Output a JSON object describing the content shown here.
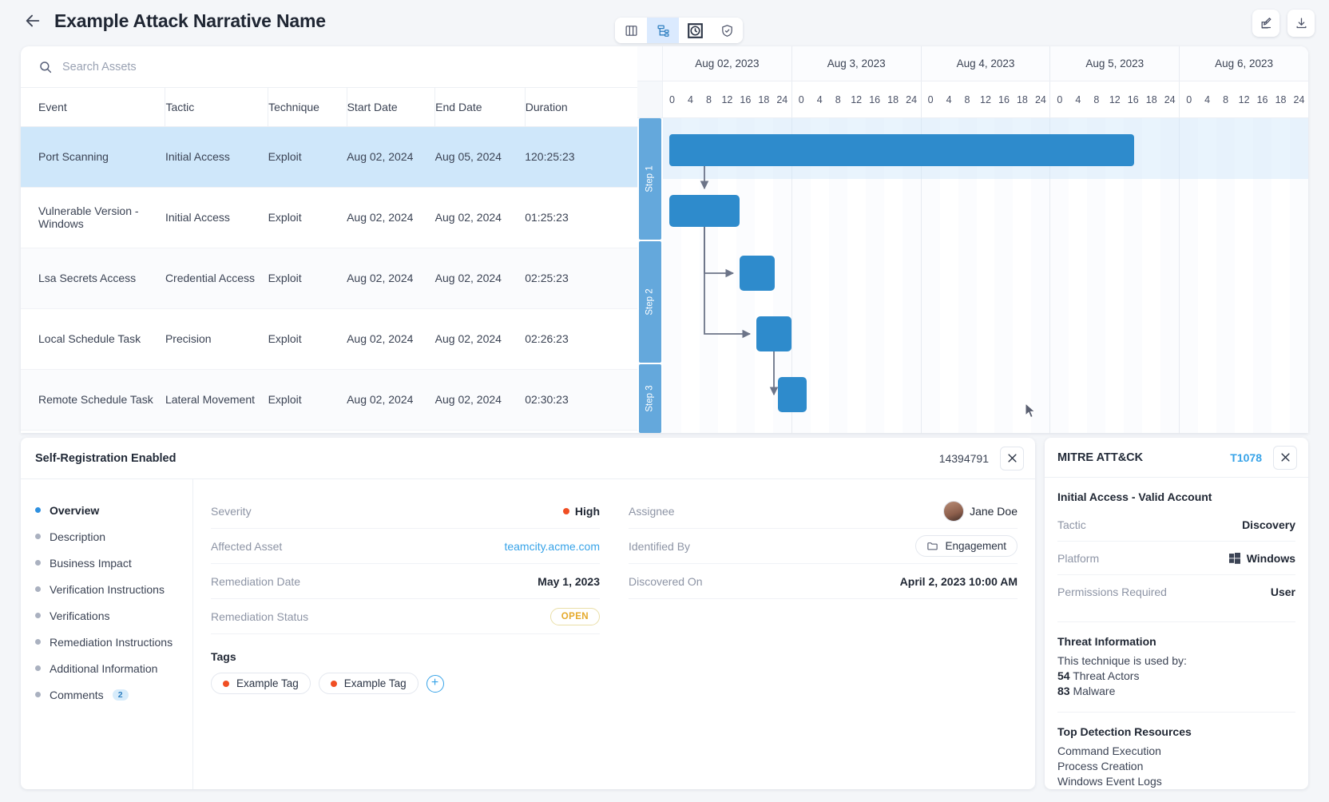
{
  "header": {
    "back_icon": "arrow-left-icon",
    "title": "Example Attack Narrative Name",
    "view_buttons": [
      {
        "name": "columns-view",
        "icon": "columns-icon",
        "active": false
      },
      {
        "name": "hierarchy-view",
        "icon": "hierarchy-icon",
        "active": true
      },
      {
        "name": "timeline-view",
        "icon": "clock-icon",
        "active": false
      },
      {
        "name": "security-view",
        "icon": "shield-check-icon",
        "active": false
      }
    ],
    "actions": [
      {
        "name": "edit-button",
        "icon": "edit-square-icon"
      },
      {
        "name": "download-button",
        "icon": "download-icon"
      }
    ]
  },
  "search": {
    "placeholder": "Search Assets",
    "value": ""
  },
  "table": {
    "columns": [
      "Event",
      "Tactic",
      "Technique",
      "Start Date",
      "End Date",
      "Duration"
    ],
    "rows": [
      {
        "event": "Port Scanning",
        "tactic": "Initial Access",
        "technique": "Exploit",
        "start": "Aug 02, 2024",
        "end": "Aug 05, 2024",
        "duration": "120:25:23"
      },
      {
        "event": "Vulnerable Version - Windows",
        "tactic": "Initial Access",
        "technique": "Exploit",
        "start": "Aug 02, 2024",
        "end": "Aug 02, 2024",
        "duration": "01:25:23"
      },
      {
        "event": "Lsa Secrets Access",
        "tactic": "Credential Access",
        "technique": "Exploit",
        "start": "Aug 02, 2024",
        "end": "Aug 02, 2024",
        "duration": "02:25:23"
      },
      {
        "event": "Local Schedule Task",
        "tactic": "Precision",
        "technique": "Exploit",
        "start": "Aug 02, 2024",
        "end": "Aug 02, 2024",
        "duration": "02:26:23"
      },
      {
        "event": "Remote Schedule Task",
        "tactic": "Lateral Movement",
        "technique": "Exploit",
        "start": "Aug 02, 2024",
        "end": "Aug 02, 2024",
        "duration": "02:30:23"
      }
    ]
  },
  "gantt": {
    "dates": [
      "Aug 02, 2023",
      "Aug 3, 2023",
      "Aug 4, 2023",
      "Aug 5, 2023",
      "Aug 6, 2023"
    ],
    "hour_ticks": [
      "0",
      "4",
      "8",
      "12",
      "16",
      "18",
      "24"
    ],
    "steps": [
      "Step 1",
      "Step 2",
      "Step 3"
    ],
    "bar_color": "#2e8bcc",
    "step_color": "#64a8dc"
  },
  "detail": {
    "title": "Self-Registration Enabled",
    "id": "14394791",
    "close_icon": "close-icon",
    "nav": [
      {
        "label": "Overview",
        "active": true
      },
      {
        "label": "Description",
        "active": false
      },
      {
        "label": "Business Impact",
        "active": false
      },
      {
        "label": "Verification Instructions",
        "active": false
      },
      {
        "label": "Verifications",
        "active": false
      },
      {
        "label": "Remediation Instructions",
        "active": false
      },
      {
        "label": "Additional Information",
        "active": false
      },
      {
        "label": "Comments",
        "active": false,
        "count": "2"
      }
    ],
    "left_fields": [
      {
        "label": "Severity",
        "value": "High",
        "type": "severity"
      },
      {
        "label": "Affected Asset",
        "value": "teamcity.acme.com",
        "type": "link"
      },
      {
        "label": "Remediation Date",
        "value": "May 1, 2023",
        "type": "text"
      },
      {
        "label": "Remediation Status",
        "value": "OPEN",
        "type": "pill"
      }
    ],
    "right_fields": [
      {
        "label": "Assignee",
        "value": "Jane Doe",
        "type": "avatar"
      },
      {
        "label": "Identified By",
        "value": "Engagement",
        "type": "chip"
      },
      {
        "label": "Discovered On",
        "value": "April 2, 2023 10:00 AM",
        "type": "text"
      }
    ],
    "tags_heading": "Tags",
    "tags": [
      "Example Tag",
      "Example Tag"
    ],
    "add_tag_icon": "plus-circle-icon"
  },
  "mitre": {
    "title": "MITRE ATT&CK",
    "technique_id": "T1078",
    "close_icon": "close-icon",
    "subtitle": "Initial Access - Valid Account",
    "rows": [
      {
        "label": "Tactic",
        "value": "Discovery",
        "icon": ""
      },
      {
        "label": "Platform",
        "value": "Windows",
        "icon": "windows-icon"
      },
      {
        "label": "Permissions Required",
        "value": "User",
        "icon": ""
      }
    ],
    "threat_heading": "Threat Information",
    "threat_intro": "This technique is used by:",
    "threat_actors": "54",
    "threat_actors_label": "Threat Actors",
    "malware": "83",
    "malware_label": "Malware",
    "detection_heading": "Top Detection Resources",
    "detection_items": [
      "Command Execution",
      "Process Creation",
      "Windows Event Logs"
    ]
  },
  "colors": {
    "accent": "#2e8bcc",
    "link": "#37a3e8",
    "severity_high": "#f04e23",
    "open": "#e5a92b"
  }
}
